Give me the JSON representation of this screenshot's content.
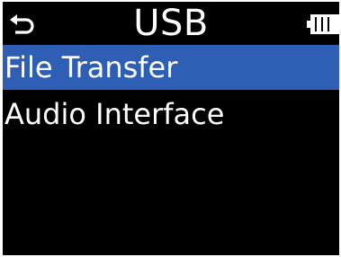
{
  "header": {
    "title": "USB",
    "back_icon": "return-arrow-icon",
    "battery_icon": "battery-full-icon"
  },
  "menu": {
    "items": [
      {
        "label": "File Transfer",
        "selected": true
      },
      {
        "label": "Audio Interface",
        "selected": false
      }
    ]
  },
  "colors": {
    "background": "#000000",
    "text": "#ffffff",
    "selection": "#2e5fb5",
    "frame": "#ffffff"
  }
}
